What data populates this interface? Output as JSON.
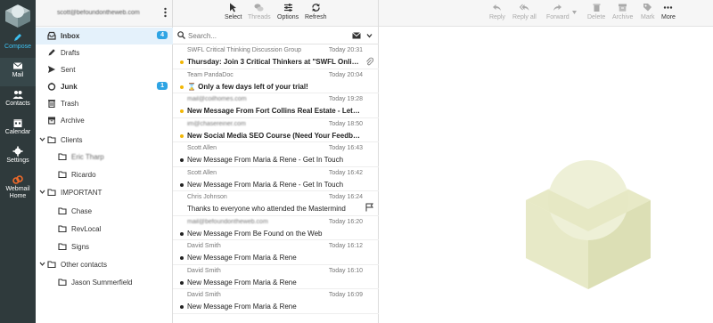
{
  "nav": {
    "items": [
      {
        "label": "Compose",
        "icon": "pencil-icon"
      },
      {
        "label": "Mail",
        "icon": "mail-icon"
      },
      {
        "label": "Contacts",
        "icon": "contacts-icon"
      },
      {
        "label": "Calendar",
        "icon": "calendar-icon"
      },
      {
        "label": "Settings",
        "icon": "gear-icon"
      },
      {
        "label": "Webmail Home",
        "icon": "cpanel-icon"
      }
    ],
    "accent": "#3ec0f0",
    "background": "#2f3a3c"
  },
  "account": {
    "email": "scott@befoundontheweb.com"
  },
  "folders": {
    "inbox": {
      "label": "Inbox",
      "count": "4"
    },
    "drafts": "Drafts",
    "sent": "Sent",
    "junk": {
      "label": "Junk",
      "count": "1"
    },
    "trash": "Trash",
    "archive": "Archive",
    "clients": "Clients",
    "eric": "Eric Tharp",
    "ricardo": "Ricardo",
    "important": "IMPORTANT",
    "chase": "Chase",
    "revlocal": "RevLocal",
    "signs": "Signs",
    "other": "Other contacts",
    "jason": "Jason Summerfield"
  },
  "list_toolbar": {
    "select": "Select",
    "threads": "Threads",
    "options": "Options",
    "refresh": "Refresh"
  },
  "search": {
    "placeholder": "Search..."
  },
  "messages": [
    {
      "from": "SWFL Critical Thinking Discussion Group",
      "date": "Today 20:31",
      "subject": "Thursday: Join 3 Critical Thinkers at \"SWFL Online Cri...",
      "unread": true,
      "dot": "yellow",
      "attachment": true
    },
    {
      "from": "Team PandaDoc",
      "date": "Today 20:04",
      "subject": "⌛ Only a few days left of your trial!",
      "unread": true,
      "dot": "yellow"
    },
    {
      "from": "mail@coilhomes.com",
      "date": "Today 19:28",
      "subject": "New Message From Fort Collins Real Estate - Let&#03...",
      "unread": true,
      "dot": "yellow"
    },
    {
      "from": "im@chasereiner.com",
      "date": "Today 18:50",
      "subject": "New Social Media SEO Course (Need Your Feedback)",
      "unread": true,
      "dot": "yellow"
    },
    {
      "from": "Scott Allen",
      "date": "Today 16:43",
      "subject": "New Message From Maria & Rene - Get In Touch",
      "unread": false,
      "dot": "black"
    },
    {
      "from": "Scott Allen",
      "date": "Today 16:42",
      "subject": "New Message From Maria & Rene - Get In Touch",
      "unread": false,
      "dot": "black"
    },
    {
      "from": "Chris Johnson",
      "date": "Today 16:24",
      "subject": "Thanks to everyone who attended the Mastermind",
      "unread": false,
      "dot": "none",
      "flag": true
    },
    {
      "from": "mail@befoundontheweb.com",
      "date": "Today 16:20",
      "subject": "New Message From Be Found on the Web",
      "unread": false,
      "dot": "black"
    },
    {
      "from": "David Smith",
      "date": "Today 16:12",
      "subject": "New Message From Maria & Rene",
      "unread": false,
      "dot": "black"
    },
    {
      "from": "David Smith",
      "date": "Today 16:10",
      "subject": "New Message From Maria & Rene",
      "unread": false,
      "dot": "black"
    },
    {
      "from": "David Smith",
      "date": "Today 16:09",
      "subject": "New Message From Maria & Rene",
      "unread": false,
      "dot": "black"
    }
  ],
  "pane_toolbar": {
    "reply": "Reply",
    "reply_all": "Reply all",
    "forward": "Forward",
    "delete": "Delete",
    "archive": "Archive",
    "mark": "Mark",
    "more": "More"
  }
}
